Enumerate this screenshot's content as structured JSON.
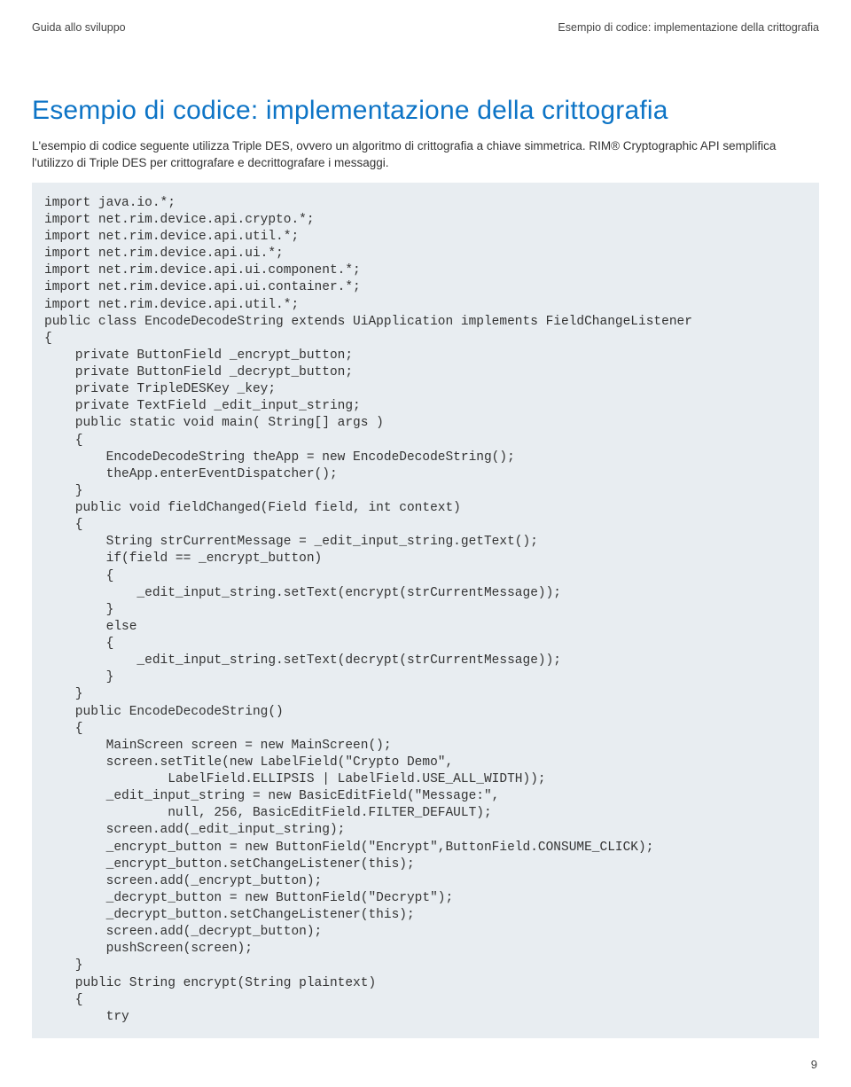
{
  "header": {
    "left": "Guida allo sviluppo",
    "right": "Esempio di codice: implementazione della crittografia"
  },
  "title": "Esempio di codice: implementazione della crittografia",
  "intro": "L'esempio di codice seguente utilizza Triple DES, ovvero un algoritmo di crittografia a chiave simmetrica. RIM® Cryptographic API semplifica l'utilizzo di Triple DES per crittografare e decrittografare i messaggi.",
  "code": "import java.io.*;\nimport net.rim.device.api.crypto.*;\nimport net.rim.device.api.util.*;\nimport net.rim.device.api.ui.*;\nimport net.rim.device.api.ui.component.*;\nimport net.rim.device.api.ui.container.*;\nimport net.rim.device.api.util.*;\npublic class EncodeDecodeString extends UiApplication implements FieldChangeListener\n{\n    private ButtonField _encrypt_button;\n    private ButtonField _decrypt_button;\n    private TripleDESKey _key;\n    private TextField _edit_input_string;\n    public static void main( String[] args )\n    {\n        EncodeDecodeString theApp = new EncodeDecodeString();\n        theApp.enterEventDispatcher();\n    }\n    public void fieldChanged(Field field, int context)\n    {\n        String strCurrentMessage = _edit_input_string.getText();\n        if(field == _encrypt_button)\n        {\n            _edit_input_string.setText(encrypt(strCurrentMessage));\n        }\n        else\n        {\n            _edit_input_string.setText(decrypt(strCurrentMessage));\n        }\n    }\n    public EncodeDecodeString()\n    {\n        MainScreen screen = new MainScreen();\n        screen.setTitle(new LabelField(\"Crypto Demo\",\n                LabelField.ELLIPSIS | LabelField.USE_ALL_WIDTH));\n        _edit_input_string = new BasicEditField(\"Message:\",\n                null, 256, BasicEditField.FILTER_DEFAULT);\n        screen.add(_edit_input_string);\n        _encrypt_button = new ButtonField(\"Encrypt\",ButtonField.CONSUME_CLICK);\n        _encrypt_button.setChangeListener(this);\n        screen.add(_encrypt_button);\n        _decrypt_button = new ButtonField(\"Decrypt\");\n        _decrypt_button.setChangeListener(this);\n        screen.add(_decrypt_button);\n        pushScreen(screen);\n    }\n    public String encrypt(String plaintext)\n    {\n        try",
  "pageNumber": "9"
}
